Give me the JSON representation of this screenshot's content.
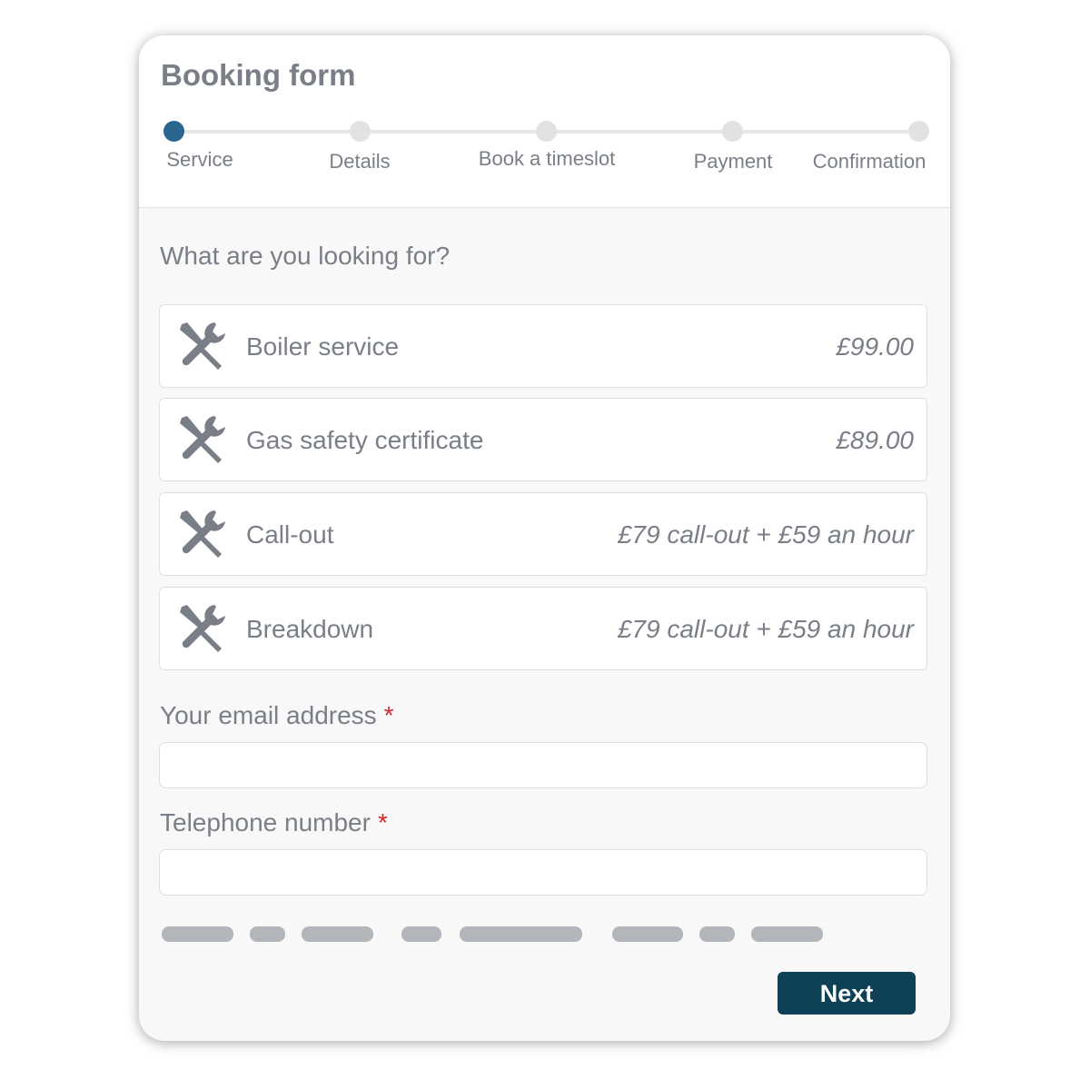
{
  "form": {
    "title": "Booking form"
  },
  "steps": [
    {
      "label": "Service",
      "active": true
    },
    {
      "label": "Details",
      "active": false
    },
    {
      "label": "Book a timeslot",
      "active": false
    },
    {
      "label": "Payment",
      "active": false
    },
    {
      "label": "Confirmation",
      "active": false
    }
  ],
  "question": "What are you looking for?",
  "options": [
    {
      "name": "Boiler service",
      "price": "£99.00",
      "icon": "tools-icon"
    },
    {
      "name": "Gas safety certificate",
      "price": "£89.00",
      "icon": "tools-icon"
    },
    {
      "name": "Call-out",
      "price": "£79 call-out + £59 an hour",
      "icon": "tools-icon"
    },
    {
      "name": "Breakdown",
      "price": "£79 call-out + £59 an hour",
      "icon": "tools-icon"
    }
  ],
  "fields": {
    "email": {
      "label": "Your email address",
      "required_mark": "*",
      "value": ""
    },
    "phone": {
      "label": "Telephone number",
      "required_mark": "*",
      "value": ""
    }
  },
  "actions": {
    "next_label": "Next"
  },
  "colors": {
    "accent": "#2b6690",
    "button": "#0e4155",
    "required": "#d9262a"
  }
}
